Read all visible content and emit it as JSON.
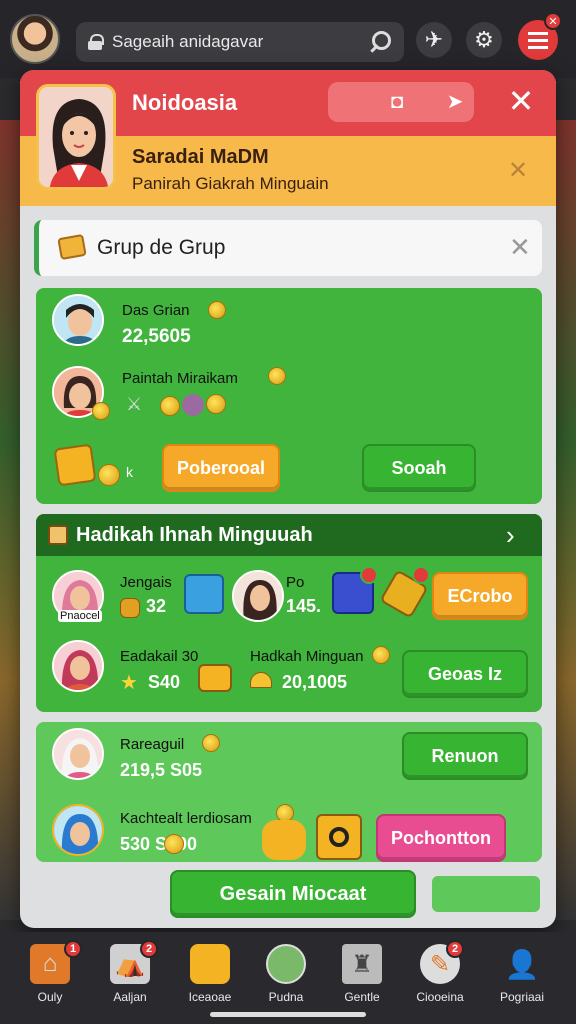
{
  "topbar": {
    "search_value": "Sageaih anidagavar",
    "icons": [
      "lock-icon",
      "search-icon",
      "paper-plane-icon",
      "gear-icon",
      "menu-icon"
    ]
  },
  "modal": {
    "title": "Noidoasia",
    "subheader_title": "Saradai MaDM",
    "subheader_text": "Panirah Giakrah Minguain",
    "group_label": "Grup de Grup",
    "card1": {
      "person1_name": "Das Grian",
      "person1_value": "22,5605",
      "person2_name": "Paintah Miraikam",
      "button_orange": "Poberooal",
      "button_green": "Sooah"
    },
    "card2": {
      "title": "Hadikah Ihnah Minguuah",
      "person1_name": "Jengais",
      "person1_caption": "Pnaocel",
      "person1_value": "32",
      "person2_name": "Po",
      "person2_value": "145.",
      "button_orange": "ECrobo",
      "person3_name": "Eadakail 30",
      "person3_value": "S40",
      "person4_name": "Hadkah Minguan",
      "person4_value": "20,1005",
      "button_green": "Geoas Iz"
    },
    "card3": {
      "person1_name": "Rareaguil",
      "person1_value": "219,5 S05",
      "button_green": "Renuon",
      "person2_name": "Kachtealt lerdiosam",
      "person2_value": "530 S600",
      "button_pink": "Pochontton"
    },
    "bottom_button": "Gesain Miocaat"
  },
  "bottom_nav": [
    {
      "label": "Ouly",
      "icon": "home-icon",
      "badge": "1"
    },
    {
      "label": "Aaljan",
      "icon": "shop-icon",
      "badge": "2"
    },
    {
      "label": "Iceaoae",
      "icon": "chest-icon",
      "badge": ""
    },
    {
      "label": "Pudna",
      "icon": "profile-avatar-icon",
      "badge": ""
    },
    {
      "label": "Gentle",
      "icon": "trophy-icon",
      "badge": ""
    },
    {
      "label": "Ciooeina",
      "icon": "rocket-icon",
      "badge": "2"
    },
    {
      "label": "Pogriaai",
      "icon": "user-icon",
      "badge": ""
    }
  ],
  "colors": {
    "header_red": "#e2454a",
    "subheader_yellow": "#f6b94a",
    "card_green": "#40b43c",
    "button_orange": "#f6a828",
    "button_pink": "#e84d92",
    "nav_bg": "#2a2a2e"
  }
}
